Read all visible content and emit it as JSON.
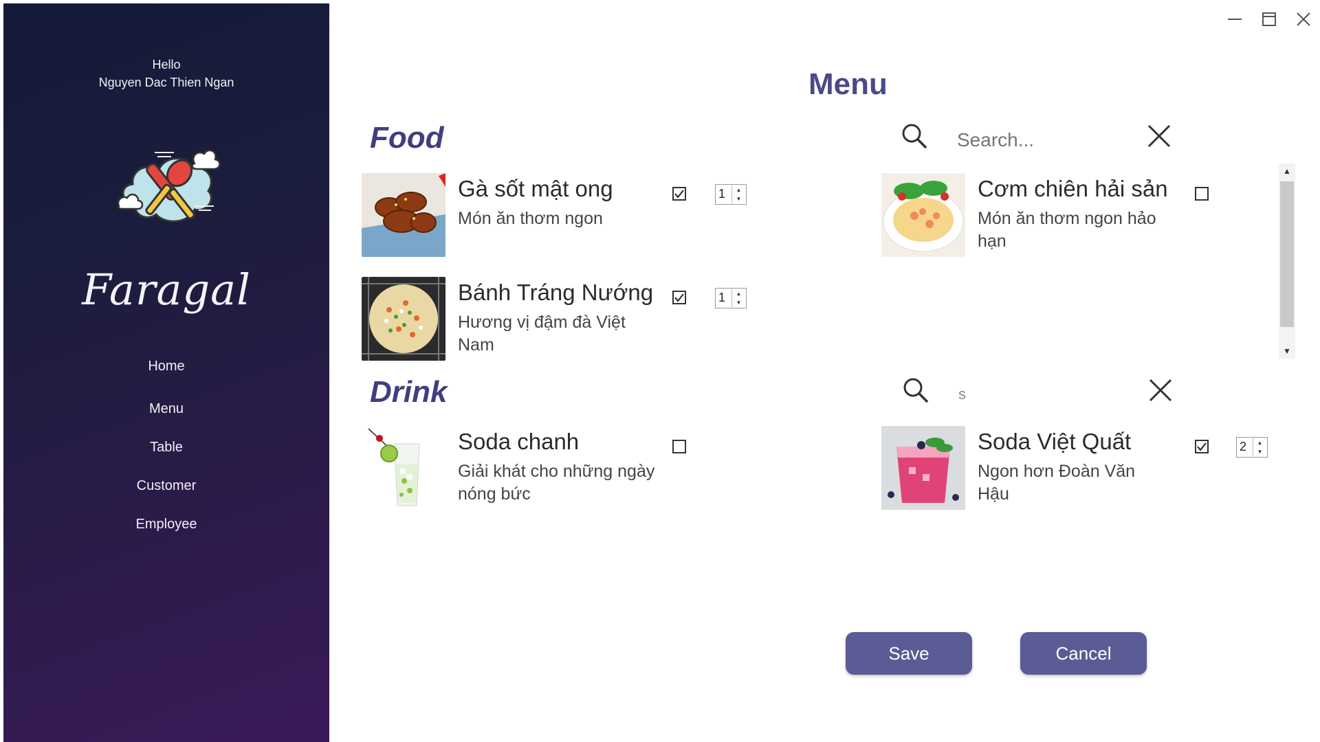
{
  "sidebar": {
    "greeting": "Hello",
    "user_name": "Nguyen Dac Thien Ngan",
    "brand": "Faragal",
    "nav": [
      "Home",
      "Menu",
      "Table",
      "Customer",
      "Employee"
    ]
  },
  "page": {
    "title": "Menu"
  },
  "food": {
    "title": "Food",
    "search": {
      "placeholder": "Search...",
      "value": ""
    },
    "items": [
      {
        "name": "Gà sốt mật ong",
        "desc": "Món ăn thơm ngon",
        "checked": true,
        "qty": "1"
      },
      {
        "name": "Cơm chiên hải sản",
        "desc": "Món ăn thơm ngon hảo hạn",
        "checked": false
      },
      {
        "name": "Bánh Tráng Nướng",
        "desc": "Hương vị đậm đà Việt Nam",
        "checked": true,
        "qty": "1"
      }
    ]
  },
  "drink": {
    "title": "Drink",
    "search": {
      "placeholder": "Search...",
      "value": "s"
    },
    "items": [
      {
        "name": "Soda chanh",
        "desc": "Giải khát cho những ngày nóng bức",
        "checked": false
      },
      {
        "name": "Soda Việt Quất",
        "desc": "Ngon hơn Đoàn Văn Hậu",
        "checked": true,
        "qty": "2"
      }
    ]
  },
  "actions": {
    "save": "Save",
    "cancel": "Cancel"
  },
  "colors": {
    "accent": "#5b5b95",
    "title": "#4a4a88",
    "sidebar_top": "#141a38",
    "sidebar_bottom": "#3a1b5a"
  }
}
